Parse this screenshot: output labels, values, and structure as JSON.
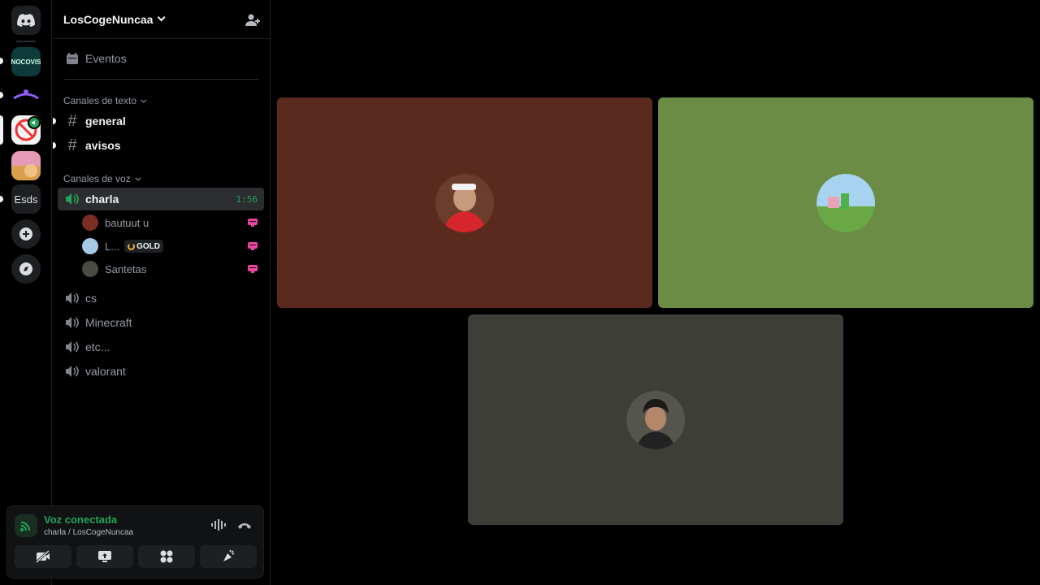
{
  "server_rail": {
    "items": [
      {
        "name": "discord-home",
        "label": ""
      },
      {
        "name": "server-nocovis",
        "label": "NOCOVIS"
      },
      {
        "name": "server-purple",
        "label": ""
      },
      {
        "name": "server-current",
        "label": ""
      },
      {
        "name": "server-minecraft",
        "label": ""
      },
      {
        "name": "server-esds",
        "label": "Esds"
      },
      {
        "name": "add-server",
        "label": ""
      },
      {
        "name": "explore",
        "label": ""
      }
    ]
  },
  "guild": {
    "name": "LosCogeNuncaa"
  },
  "sidebar": {
    "events_label": "Eventos",
    "text_category": "Canales de texto",
    "text_channels": [
      {
        "label": "general"
      },
      {
        "label": "avisos"
      }
    ],
    "voice_category": "Canales de voz",
    "active_voice": {
      "label": "charla",
      "timer": "1:56"
    },
    "voice_users": [
      {
        "name": "bautuut u",
        "display": "bautuut u"
      },
      {
        "name": "L...",
        "display": "L...",
        "tag": "GOLD"
      },
      {
        "name": "Santetas",
        "display": "Santetas"
      }
    ],
    "voice_channels": [
      {
        "label": "cs"
      },
      {
        "label": "Minecraft"
      },
      {
        "label": "etc..."
      },
      {
        "label": "valorant"
      }
    ]
  },
  "voice_panel": {
    "status": "Voz conectada",
    "location": "charla / LosCogeNuncaa"
  },
  "tiles": [
    {
      "color": "#5a2a1e"
    },
    {
      "color": "#6a8c45"
    },
    {
      "color": "#3e3e38"
    }
  ],
  "colors": {
    "accent_green": "#23a55a",
    "stream_pink": "#eb459f"
  }
}
